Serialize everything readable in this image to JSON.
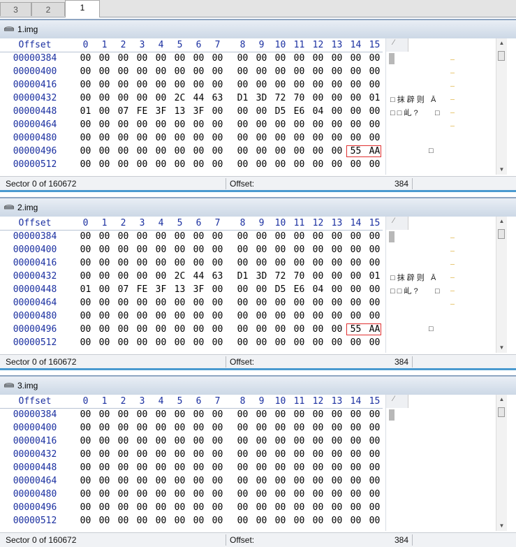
{
  "tabs": [
    "3",
    "2",
    "1"
  ],
  "active_tab": "1",
  "offset_label": "Offset",
  "columns": [
    "0",
    "1",
    "2",
    "3",
    "4",
    "5",
    "6",
    "7",
    "8",
    "9",
    "10",
    "11",
    "12",
    "13",
    "14",
    "15"
  ],
  "panes": [
    {
      "title": "1.img",
      "rows": [
        {
          "offset": "00000384",
          "bytes": [
            "00",
            "00",
            "00",
            "00",
            "00",
            "00",
            "00",
            "00",
            "00",
            "00",
            "00",
            "00",
            "00",
            "00",
            "00",
            "00"
          ]
        },
        {
          "offset": "00000400",
          "bytes": [
            "00",
            "00",
            "00",
            "00",
            "00",
            "00",
            "00",
            "00",
            "00",
            "00",
            "00",
            "00",
            "00",
            "00",
            "00",
            "00"
          ]
        },
        {
          "offset": "00000416",
          "bytes": [
            "00",
            "00",
            "00",
            "00",
            "00",
            "00",
            "00",
            "00",
            "00",
            "00",
            "00",
            "00",
            "00",
            "00",
            "00",
            "00"
          ]
        },
        {
          "offset": "00000432",
          "bytes": [
            "00",
            "00",
            "00",
            "00",
            "00",
            "2C",
            "44",
            "63",
            "D1",
            "3D",
            "72",
            "70",
            "00",
            "00",
            "00",
            "01"
          ]
        },
        {
          "offset": "00000448",
          "bytes": [
            "01",
            "00",
            "07",
            "FE",
            "3F",
            "13",
            "3F",
            "00",
            "00",
            "00",
            "D5",
            "E6",
            "04",
            "00",
            "00",
            "00"
          ]
        },
        {
          "offset": "00000464",
          "bytes": [
            "00",
            "00",
            "00",
            "00",
            "00",
            "00",
            "00",
            "00",
            "00",
            "00",
            "00",
            "00",
            "00",
            "00",
            "00",
            "00"
          ]
        },
        {
          "offset": "00000480",
          "bytes": [
            "00",
            "00",
            "00",
            "00",
            "00",
            "00",
            "00",
            "00",
            "00",
            "00",
            "00",
            "00",
            "00",
            "00",
            "00",
            "00"
          ]
        },
        {
          "offset": "00000496",
          "bytes": [
            "00",
            "00",
            "00",
            "00",
            "00",
            "00",
            "00",
            "00",
            "00",
            "00",
            "00",
            "00",
            "00",
            "00",
            "55",
            "AA"
          ]
        },
        {
          "offset": "00000512",
          "bytes": [
            "00",
            "00",
            "00",
            "00",
            "00",
            "00",
            "00",
            "00",
            "00",
            "00",
            "00",
            "00",
            "00",
            "00",
            "00",
            "00"
          ]
        }
      ],
      "text_rows": [
        "",
        "",
        "",
        "□ 抹 辟 则   Ā",
        "□ □ 乢 ?        □",
        "",
        "",
        "                  □",
        ""
      ],
      "status": {
        "sector": "Sector 0 of 160672",
        "offset_label": "Offset:",
        "offset_value": "384"
      }
    },
    {
      "title": "2.img",
      "rows": [
        {
          "offset": "00000384",
          "bytes": [
            "00",
            "00",
            "00",
            "00",
            "00",
            "00",
            "00",
            "00",
            "00",
            "00",
            "00",
            "00",
            "00",
            "00",
            "00",
            "00"
          ]
        },
        {
          "offset": "00000400",
          "bytes": [
            "00",
            "00",
            "00",
            "00",
            "00",
            "00",
            "00",
            "00",
            "00",
            "00",
            "00",
            "00",
            "00",
            "00",
            "00",
            "00"
          ]
        },
        {
          "offset": "00000416",
          "bytes": [
            "00",
            "00",
            "00",
            "00",
            "00",
            "00",
            "00",
            "00",
            "00",
            "00",
            "00",
            "00",
            "00",
            "00",
            "00",
            "00"
          ]
        },
        {
          "offset": "00000432",
          "bytes": [
            "00",
            "00",
            "00",
            "00",
            "00",
            "2C",
            "44",
            "63",
            "D1",
            "3D",
            "72",
            "70",
            "00",
            "00",
            "00",
            "01"
          ]
        },
        {
          "offset": "00000448",
          "bytes": [
            "01",
            "00",
            "07",
            "FE",
            "3F",
            "13",
            "3F",
            "00",
            "00",
            "00",
            "D5",
            "E6",
            "04",
            "00",
            "00",
            "00"
          ]
        },
        {
          "offset": "00000464",
          "bytes": [
            "00",
            "00",
            "00",
            "00",
            "00",
            "00",
            "00",
            "00",
            "00",
            "00",
            "00",
            "00",
            "00",
            "00",
            "00",
            "00"
          ]
        },
        {
          "offset": "00000480",
          "bytes": [
            "00",
            "00",
            "00",
            "00",
            "00",
            "00",
            "00",
            "00",
            "00",
            "00",
            "00",
            "00",
            "00",
            "00",
            "00",
            "00"
          ]
        },
        {
          "offset": "00000496",
          "bytes": [
            "00",
            "00",
            "00",
            "00",
            "00",
            "00",
            "00",
            "00",
            "00",
            "00",
            "00",
            "00",
            "00",
            "00",
            "55",
            "AA"
          ]
        },
        {
          "offset": "00000512",
          "bytes": [
            "00",
            "00",
            "00",
            "00",
            "00",
            "00",
            "00",
            "00",
            "00",
            "00",
            "00",
            "00",
            "00",
            "00",
            "00",
            "00"
          ]
        }
      ],
      "text_rows": [
        "",
        "",
        "",
        "□ 抹 辟 则   Ā",
        "□ □ 乢 ?        □",
        "",
        "",
        "                  □",
        ""
      ],
      "status": {
        "sector": "Sector 0 of 160672",
        "offset_label": "Offset:",
        "offset_value": "384"
      }
    },
    {
      "title": "3.img",
      "rows": [
        {
          "offset": "00000384",
          "bytes": [
            "00",
            "00",
            "00",
            "00",
            "00",
            "00",
            "00",
            "00",
            "00",
            "00",
            "00",
            "00",
            "00",
            "00",
            "00",
            "00"
          ]
        },
        {
          "offset": "00000400",
          "bytes": [
            "00",
            "00",
            "00",
            "00",
            "00",
            "00",
            "00",
            "00",
            "00",
            "00",
            "00",
            "00",
            "00",
            "00",
            "00",
            "00"
          ]
        },
        {
          "offset": "00000416",
          "bytes": [
            "00",
            "00",
            "00",
            "00",
            "00",
            "00",
            "00",
            "00",
            "00",
            "00",
            "00",
            "00",
            "00",
            "00",
            "00",
            "00"
          ]
        },
        {
          "offset": "00000432",
          "bytes": [
            "00",
            "00",
            "00",
            "00",
            "00",
            "00",
            "00",
            "00",
            "00",
            "00",
            "00",
            "00",
            "00",
            "00",
            "00",
            "00"
          ]
        },
        {
          "offset": "00000448",
          "bytes": [
            "00",
            "00",
            "00",
            "00",
            "00",
            "00",
            "00",
            "00",
            "00",
            "00",
            "00",
            "00",
            "00",
            "00",
            "00",
            "00"
          ]
        },
        {
          "offset": "00000464",
          "bytes": [
            "00",
            "00",
            "00",
            "00",
            "00",
            "00",
            "00",
            "00",
            "00",
            "00",
            "00",
            "00",
            "00",
            "00",
            "00",
            "00"
          ]
        },
        {
          "offset": "00000480",
          "bytes": [
            "00",
            "00",
            "00",
            "00",
            "00",
            "00",
            "00",
            "00",
            "00",
            "00",
            "00",
            "00",
            "00",
            "00",
            "00",
            "00"
          ]
        },
        {
          "offset": "00000496",
          "bytes": [
            "00",
            "00",
            "00",
            "00",
            "00",
            "00",
            "00",
            "00",
            "00",
            "00",
            "00",
            "00",
            "00",
            "00",
            "00",
            "00"
          ]
        },
        {
          "offset": "00000512",
          "bytes": [
            "00",
            "00",
            "00",
            "00",
            "00",
            "00",
            "00",
            "00",
            "00",
            "00",
            "00",
            "00",
            "00",
            "00",
            "00",
            "00"
          ]
        }
      ],
      "text_rows": [
        "",
        "",
        "",
        "",
        "",
        "",
        "",
        "",
        ""
      ],
      "status": {
        "sector": "Sector 0 of 160672",
        "offset_label": "Offset:",
        "offset_value": "384"
      }
    }
  ],
  "colors": {
    "offset_text": "#1a2fa0",
    "highlight_border": "#e03030",
    "title_gradient_top": "#e9eef5",
    "title_gradient_bottom": "#ccd8e6"
  },
  "icons": {
    "title": "disk-drive-icon",
    "text_header": "pencil-icon",
    "scroll_up": "scroll-up-arrow",
    "scroll_down": "scroll-down-arrow"
  }
}
